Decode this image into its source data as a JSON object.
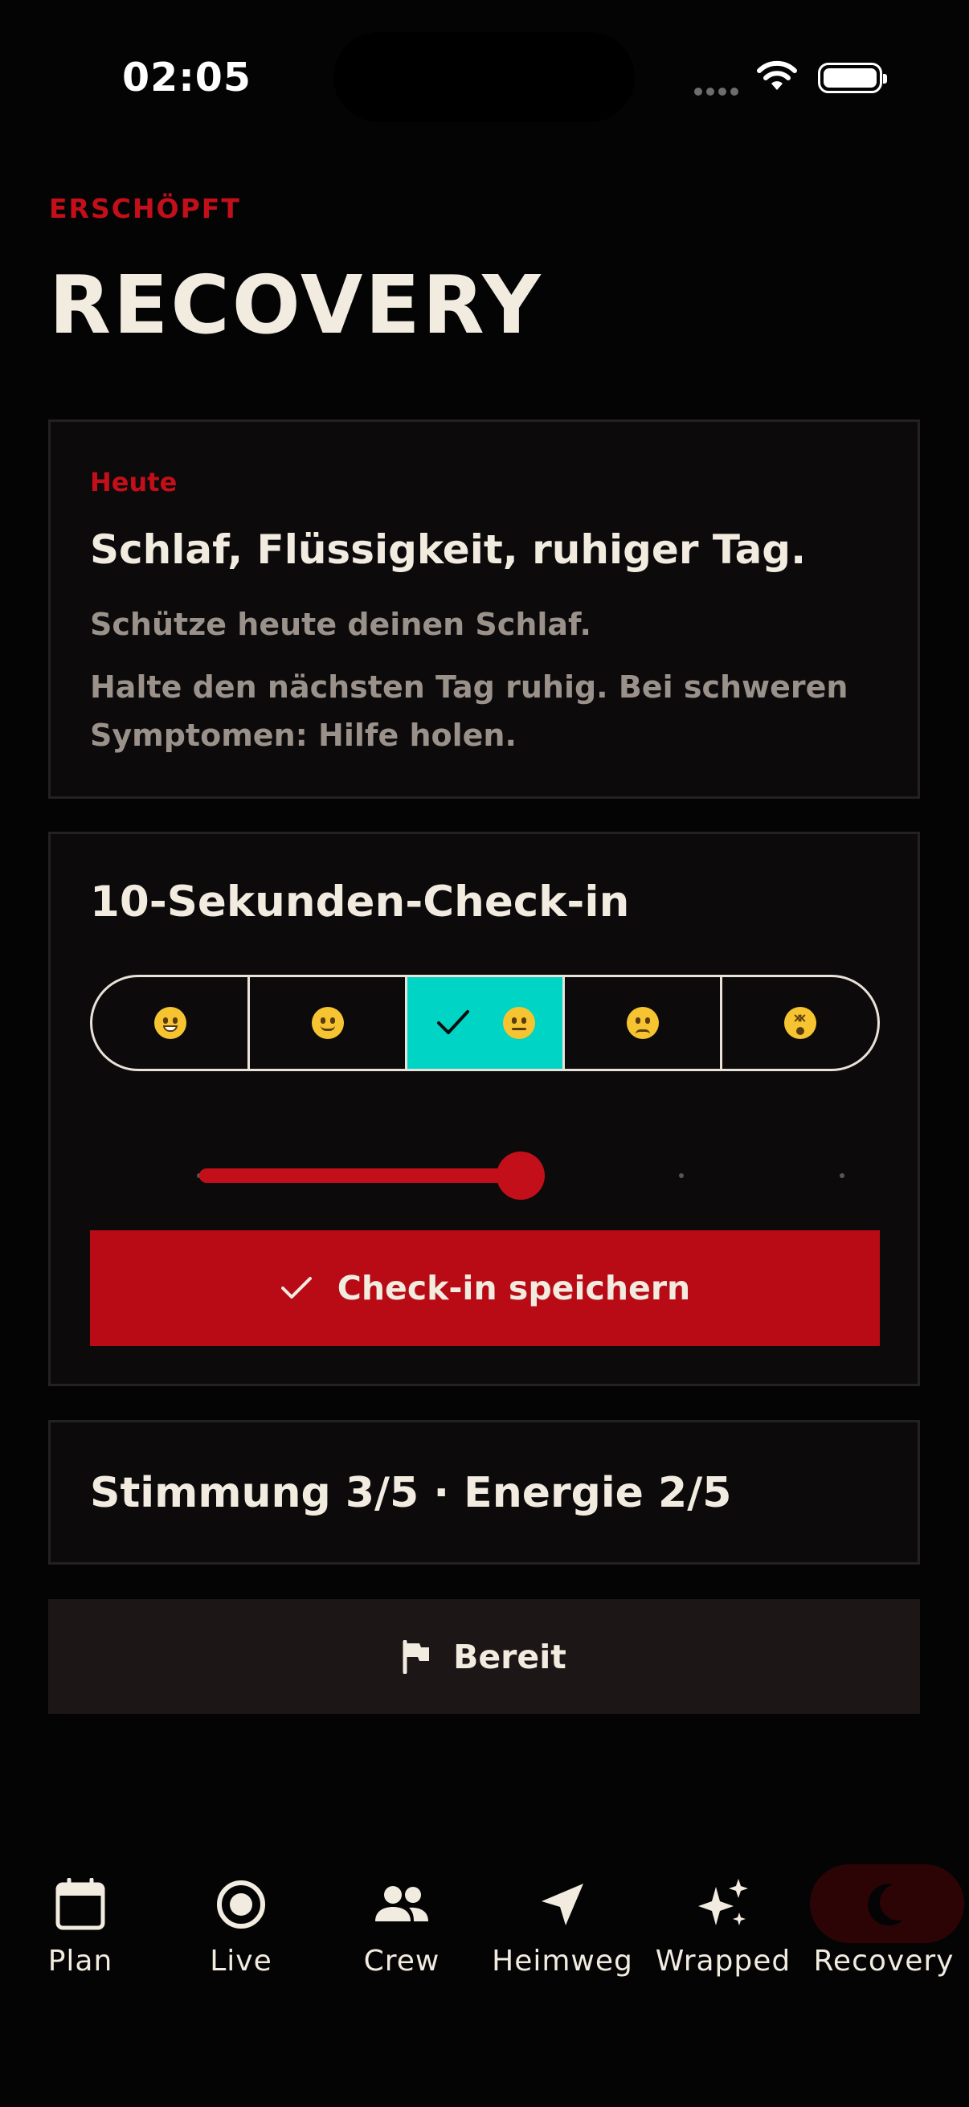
{
  "status_bar": {
    "time": "02:05"
  },
  "header": {
    "eyebrow": "ERSCHÖPFT",
    "title": "RECOVERY"
  },
  "today_card": {
    "label": "Heute",
    "headline": "Schlaf, Flüssigkeit, ruhiger Tag.",
    "line1": "Schütze heute deinen Schlaf.",
    "line2": "Halte den nächsten Tag ruhig. Bei schweren Symptomen: Hilfe holen."
  },
  "checkin_card": {
    "title": "10-Sekunden-Check-in",
    "moods": [
      {
        "icon": "grinning-face-icon",
        "selected": false
      },
      {
        "icon": "slightly-smiling-face-icon",
        "selected": false
      },
      {
        "icon": "neutral-face-icon",
        "selected": true
      },
      {
        "icon": "pensive-face-icon",
        "selected": false
      },
      {
        "icon": "dizzy-face-icon",
        "selected": false
      }
    ],
    "energy_level": 3,
    "energy_max": 5,
    "save_label": "Check-in speichern"
  },
  "summary": {
    "text": "Stimmung 3/5 · Energie 2/5"
  },
  "ready_button": {
    "label": "Bereit"
  },
  "tabbar": {
    "items": [
      {
        "label": "Plan",
        "icon": "calendar-icon",
        "active": false
      },
      {
        "label": "Live",
        "icon": "record-icon",
        "active": false
      },
      {
        "label": "Crew",
        "icon": "people-icon",
        "active": false
      },
      {
        "label": "Heimweg",
        "icon": "navigation-arrow-icon",
        "active": false
      },
      {
        "label": "Wrapped",
        "icon": "sparkles-icon",
        "active": false
      },
      {
        "label": "Recovery",
        "icon": "moon-icon",
        "active": true
      }
    ]
  },
  "colors": {
    "accent": "#c20f19",
    "selected": "#00d4c4",
    "background": "#050405",
    "text": "#f1ebe0"
  }
}
